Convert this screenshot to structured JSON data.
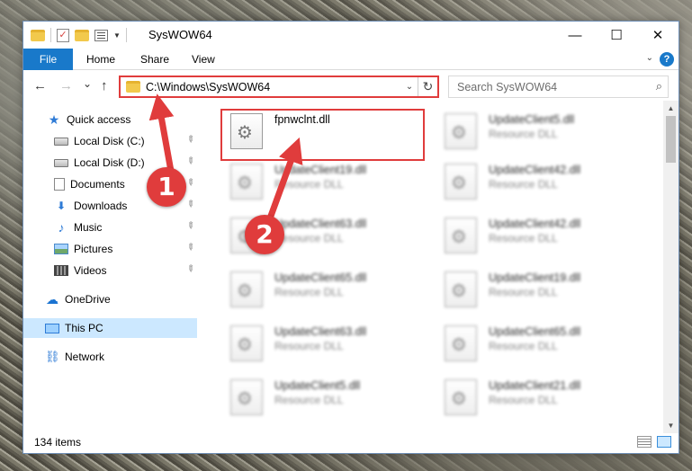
{
  "window": {
    "title": "SysWOW64",
    "controls": {
      "minimize": "—",
      "maximize": "☐",
      "close": "✕"
    }
  },
  "ribbon": {
    "tabs": [
      "File",
      "Home",
      "Share",
      "View"
    ],
    "help": "?"
  },
  "navigation": {
    "back_icon": "←",
    "forward_icon": "→",
    "recent_icon": "⌄",
    "up_icon": "↑",
    "address": "C:\\Windows\\SysWOW64",
    "search_placeholder": "Search SysWOW64"
  },
  "sidebar": {
    "items": [
      {
        "label": "Quick access",
        "icon": "star-icon",
        "glyph": "★",
        "pinned": false
      },
      {
        "label": "Local Disk (C:)",
        "icon": "disk-icon",
        "glyph": "",
        "pinned": true
      },
      {
        "label": "Local Disk (D:)",
        "icon": "disk-icon",
        "glyph": "",
        "pinned": true
      },
      {
        "label": "Documents",
        "icon": "document-icon",
        "glyph": "",
        "pinned": true
      },
      {
        "label": "Downloads",
        "icon": "download-icon",
        "glyph": "⬇",
        "pinned": true
      },
      {
        "label": "Music",
        "icon": "music-icon",
        "glyph": "♪",
        "pinned": true
      },
      {
        "label": "Pictures",
        "icon": "pictures-icon",
        "glyph": "",
        "pinned": true
      },
      {
        "label": "Videos",
        "icon": "videos-icon",
        "glyph": "",
        "pinned": true
      },
      {
        "label": "OneDrive",
        "icon": "cloud-icon",
        "glyph": "☁",
        "pinned": false
      },
      {
        "label": "This PC",
        "icon": "computer-icon",
        "glyph": "",
        "pinned": false,
        "selected": true
      },
      {
        "label": "Network",
        "icon": "network-icon",
        "glyph": "⛓",
        "pinned": false
      }
    ],
    "pin_glyph": "📌"
  },
  "files": {
    "highlighted": {
      "name": "fpnwclnt.dll",
      "type": ""
    },
    "column1": [
      {
        "name": "UpdateClient19.dll",
        "type": "Resource DLL"
      },
      {
        "name": "UpdateClient63.dll",
        "type": "Resource DLL"
      },
      {
        "name": "UpdateClient65.dll",
        "type": "Resource DLL"
      },
      {
        "name": "UpdateClient63.dll",
        "type": "Resource DLL"
      },
      {
        "name": "UpdateClient5.dll",
        "type": "Resource DLL"
      }
    ],
    "column2": [
      {
        "name": "UpdateClient5.dll",
        "type": "Resource DLL"
      },
      {
        "name": "UpdateClient42.dll",
        "type": "Resource DLL"
      },
      {
        "name": "UpdateClient42.dll",
        "type": "Resource DLL"
      },
      {
        "name": "UpdateClient19.dll",
        "type": "Resource DLL"
      },
      {
        "name": "UpdateClient65.dll",
        "type": "Resource DLL"
      },
      {
        "name": "UpdateClient21.dll",
        "type": "Resource DLL"
      }
    ]
  },
  "status": {
    "item_count": "134 items"
  },
  "annotations": {
    "step1": "1",
    "step2": "2",
    "color": "#e03c3c"
  }
}
